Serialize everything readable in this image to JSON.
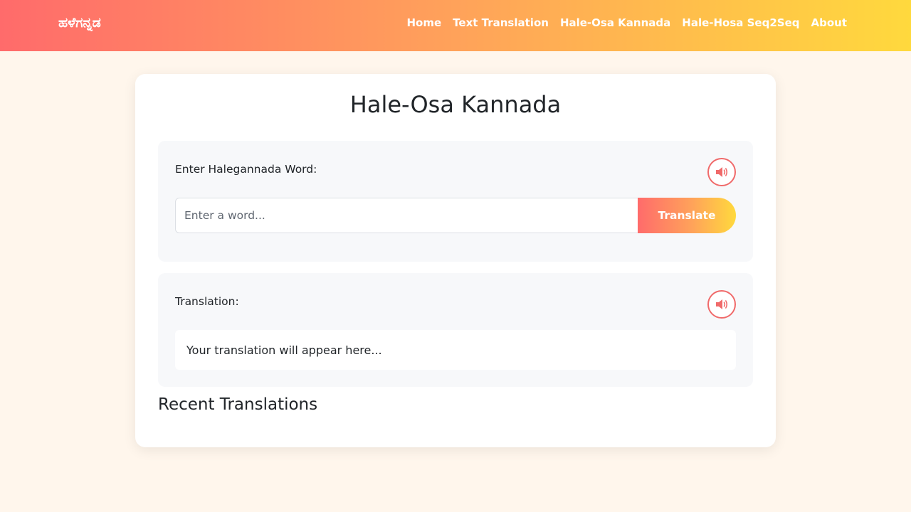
{
  "navbar": {
    "brand": "ಹಳೆಗನ್ನಡ",
    "links": [
      "Home",
      "Text Translation",
      "Hale-Osa Kannada",
      "Hale-Hosa Seq2Seq",
      "About"
    ]
  },
  "main": {
    "title": "Hale-Osa Kannada",
    "input_panel": {
      "label": "Enter Halegannada Word:",
      "placeholder": "Enter a word...",
      "translate_label": "Translate",
      "speaker_icon": "volume-icon"
    },
    "output_panel": {
      "label": "Translation:",
      "result": "Your translation will appear here...",
      "speaker_icon": "volume-icon"
    },
    "recent_title": "Recent Translations"
  },
  "colors": {
    "page_bg": "#fff6ec",
    "gradient_start": "#ff6b6b",
    "gradient_mid": "#ffa25a",
    "gradient_end": "#ffd93d",
    "accent": "#f06a6a",
    "panel_bg": "#f7f8fa"
  }
}
